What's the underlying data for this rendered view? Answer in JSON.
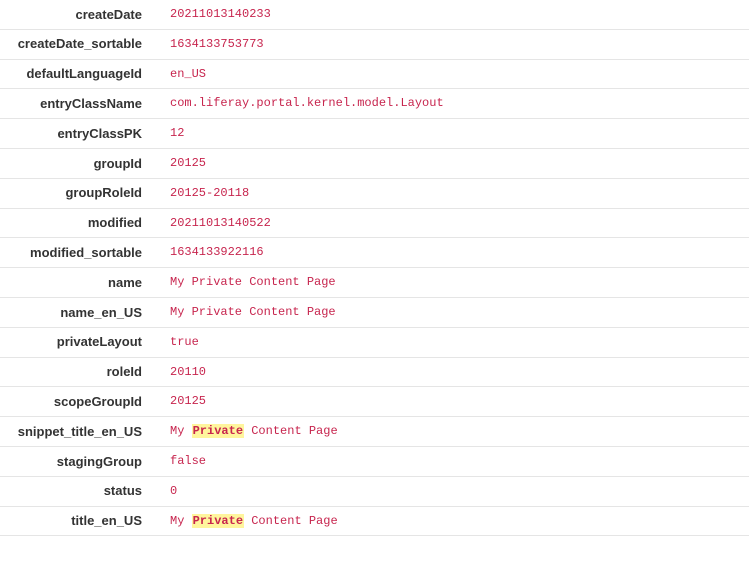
{
  "fields": [
    {
      "label": "createDate",
      "value": "20211013140233"
    },
    {
      "label": "createDate_sortable",
      "value": "1634133753773"
    },
    {
      "label": "defaultLanguageId",
      "value": "en_US"
    },
    {
      "label": "entryClassName",
      "value": "com.liferay.portal.kernel.model.Layout"
    },
    {
      "label": "entryClassPK",
      "value": "12"
    },
    {
      "label": "groupId",
      "value": "20125"
    },
    {
      "label": "groupRoleId",
      "value": "20125-20118"
    },
    {
      "label": "modified",
      "value": "20211013140522"
    },
    {
      "label": "modified_sortable",
      "value": "1634133922116"
    },
    {
      "label": "name",
      "value": "My Private Content Page"
    },
    {
      "label": "name_en_US",
      "value": "My Private Content Page"
    },
    {
      "label": "privateLayout",
      "value": "true"
    },
    {
      "label": "roleId",
      "value": "20110"
    },
    {
      "label": "scopeGroupId",
      "value": "20125"
    },
    {
      "label": "snippet_title_en_US",
      "value_parts": [
        {
          "text": "My "
        },
        {
          "text": "Private",
          "highlight": true
        },
        {
          "text": " Content Page"
        }
      ]
    },
    {
      "label": "stagingGroup",
      "value": "false"
    },
    {
      "label": "status",
      "value": "0"
    },
    {
      "label": "title_en_US",
      "value_parts": [
        {
          "text": "My "
        },
        {
          "text": "Private",
          "highlight": true
        },
        {
          "text": " Content Page"
        }
      ]
    }
  ]
}
